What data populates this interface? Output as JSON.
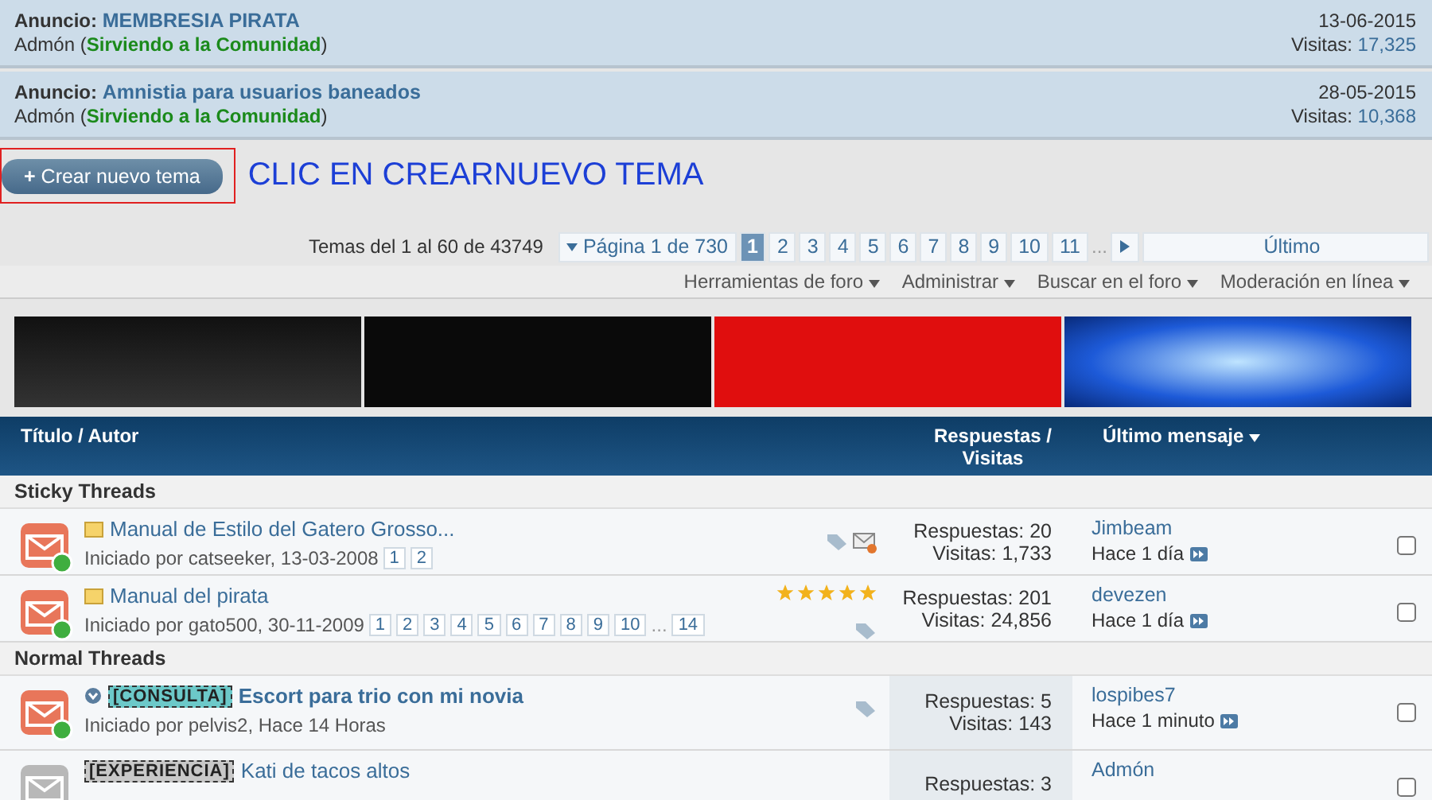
{
  "announcements": [
    {
      "label": "Anuncio:",
      "title": "MEMBRESIA PIRATA",
      "author": "Admón (",
      "role": "Sirviendo a la Comunidad",
      "close": ")",
      "date": "13-06-2015",
      "views_label": "Visitas:",
      "views": "17,325"
    },
    {
      "label": "Anuncio:",
      "title": "Amnistia para usuarios baneados",
      "author": "Admón (",
      "role": "Sirviendo a la Comunidad",
      "close": ")",
      "date": "28-05-2015",
      "views_label": "Visitas:",
      "views": "10,368"
    }
  ],
  "create_button": {
    "icon": "+",
    "label": "Crear nuevo tema"
  },
  "annotation": "CLIC EN CREARNUEVO TEMA",
  "pager": {
    "summary": "Temas del 1 al 60 de 43749",
    "page_label": "Página 1 de 730",
    "pages": [
      {
        "label": "1",
        "selected": true
      },
      {
        "label": "2",
        "selected": false
      },
      {
        "label": "3",
        "selected": false
      },
      {
        "label": "4",
        "selected": false
      },
      {
        "label": "5",
        "selected": false
      },
      {
        "label": "6",
        "selected": false
      },
      {
        "label": "7",
        "selected": false
      },
      {
        "label": "8",
        "selected": false
      },
      {
        "label": "9",
        "selected": false
      },
      {
        "label": "10",
        "selected": false
      },
      {
        "label": "11",
        "selected": false
      }
    ],
    "ellipsis": "...",
    "last": "Último"
  },
  "tools": [
    "Herramientas de foro",
    "Administrar",
    "Buscar en el foro",
    "Moderación en línea"
  ],
  "table": {
    "col_title": "Título / Autor",
    "col_stats": "Respuestas / Visitas",
    "col_last": "Último mensaje"
  },
  "sections": [
    {
      "title": "Sticky Threads",
      "threads": [
        {
          "read": false,
          "unread": false,
          "title": "Manual de Estilo del Gatero Grosso...",
          "starter": "Iniciado por catseeker, 13-03-2008",
          "pages": [
            "1",
            "2"
          ],
          "replies": "Respuestas: 20",
          "views": "Visitas: 1,733",
          "last_user": "Jimbeam",
          "last_time": "Hace 1 día",
          "mail": true,
          "checked": false
        },
        {
          "read": false,
          "unread": false,
          "title": "Manual del pirata",
          "starter": "Iniciado por gato500, 30-11-2009",
          "pages": [
            "1",
            "2",
            "3",
            "4",
            "5",
            "6",
            "7",
            "8",
            "9",
            "10",
            "...",
            "14"
          ],
          "stars": 5,
          "replies": "Respuestas: 201",
          "views": "Visitas: 24,856",
          "last_user": "devezen",
          "last_time": "Hace 1 día",
          "checked": false
        }
      ]
    },
    {
      "title": "Normal Threads",
      "threads": [
        {
          "read": false,
          "unread": true,
          "prefix": {
            "text": "[CONSULTA]",
            "color": "#6cc9c9"
          },
          "title": "Escort para trio con mi novia",
          "starter": "Iniciado por pelvis2, Hace 14 Horas",
          "replies": "Respuestas: 5",
          "views": "Visitas: 143",
          "last_user": "lospibes7",
          "last_time": "Hace 1 minuto",
          "checked": false
        },
        {
          "read": true,
          "unread": false,
          "prefix": {
            "text": "[EXPERIENCIA]",
            "color": "#c8c8c8"
          },
          "title": "Kati de tacos altos",
          "replies": "Respuestas: 3",
          "last_user": "Admón",
          "checked": false
        }
      ]
    }
  ]
}
